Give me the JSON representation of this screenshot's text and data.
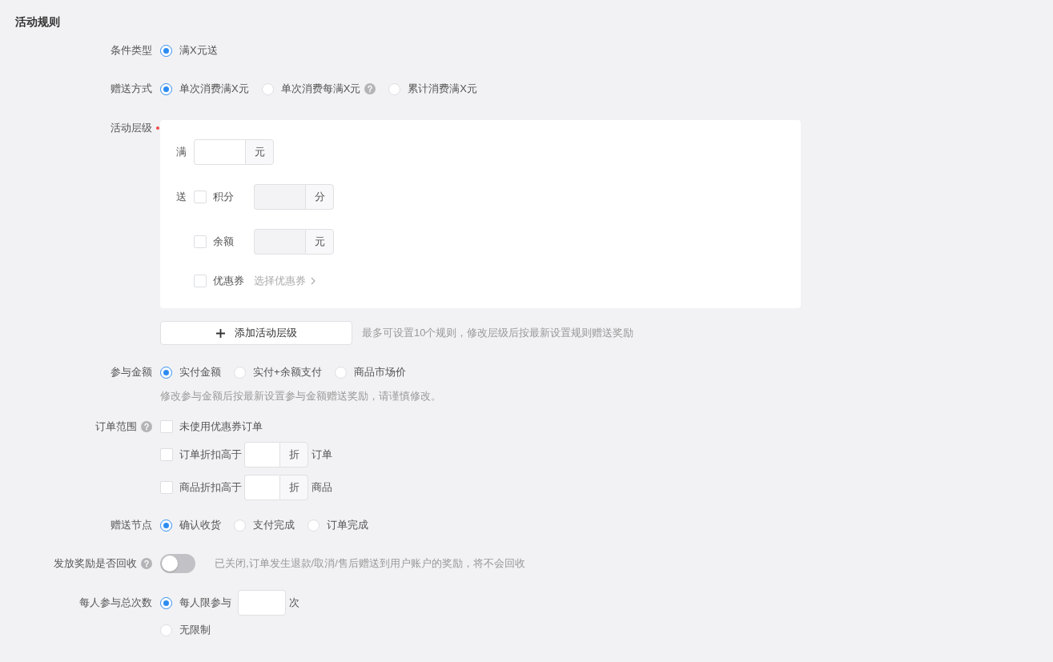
{
  "section_title": "活动规则",
  "condition_type": {
    "label": "条件类型",
    "options": [
      {
        "label": "满X元送",
        "selected": true,
        "help": false
      }
    ]
  },
  "gift_method": {
    "label": "赠送方式",
    "options": [
      {
        "label": "单次消费满X元",
        "selected": true,
        "help": false
      },
      {
        "label": "单次消费每满X元",
        "selected": false,
        "help": true
      },
      {
        "label": "累计消费满X元",
        "selected": false,
        "help": false
      }
    ]
  },
  "tiers": {
    "label": "活动层级",
    "required": true,
    "threshold": {
      "prefix": "满",
      "unit": "元",
      "disabled": false
    },
    "gift_prefix": "送",
    "gifts": [
      {
        "kind": "field",
        "label": "积分",
        "checked": false,
        "unit": "分",
        "disabled": true
      },
      {
        "kind": "field",
        "label": "余额",
        "checked": false,
        "unit": "元",
        "disabled": true
      },
      {
        "kind": "link",
        "label": "优惠券",
        "checked": false,
        "link": "选择优惠券"
      }
    ]
  },
  "add_tier": {
    "button": "添加活动层级",
    "hint": "最多可设置10个规则，修改层级后按最新设置规则赠送奖励"
  },
  "amount": {
    "label": "参与金额",
    "options": [
      {
        "label": "实付金额",
        "selected": true,
        "help": false
      },
      {
        "label": "实付+余额支付",
        "selected": false,
        "help": false
      },
      {
        "label": "商品市场价",
        "selected": false,
        "help": false
      }
    ],
    "hint": "修改参与金额后按最新设置参与金额赠送奖励，请谨慎修改。"
  },
  "order_scope": {
    "label": "订单范围",
    "help": true,
    "items": [
      {
        "kind": "plain",
        "label": "未使用优惠券订单",
        "checked": false
      },
      {
        "kind": "discount",
        "label": "订单折扣高于",
        "checked": false,
        "unit": "折",
        "suffix": "订单"
      },
      {
        "kind": "discount",
        "label": "商品折扣高于",
        "checked": false,
        "unit": "折",
        "suffix": "商品"
      }
    ]
  },
  "gift_node": {
    "label": "赠送节点",
    "options": [
      {
        "label": "确认收货",
        "selected": true,
        "help": false
      },
      {
        "label": "支付完成",
        "selected": false,
        "help": false
      },
      {
        "label": "订单完成",
        "selected": false,
        "help": false
      }
    ]
  },
  "reclaim": {
    "label": "发放奖励是否回收",
    "help": true,
    "on": false,
    "hint": "已关闭,订单发生退款/取消/售后赠送到用户账户的奖励，将不会回收"
  },
  "limit": {
    "label": "每人参与总次数",
    "options": [
      {
        "kind": "limited",
        "label": "每人限参与",
        "selected": true,
        "suffix": "次"
      },
      {
        "kind": "plain",
        "label": "无限制",
        "selected": false
      }
    ]
  }
}
